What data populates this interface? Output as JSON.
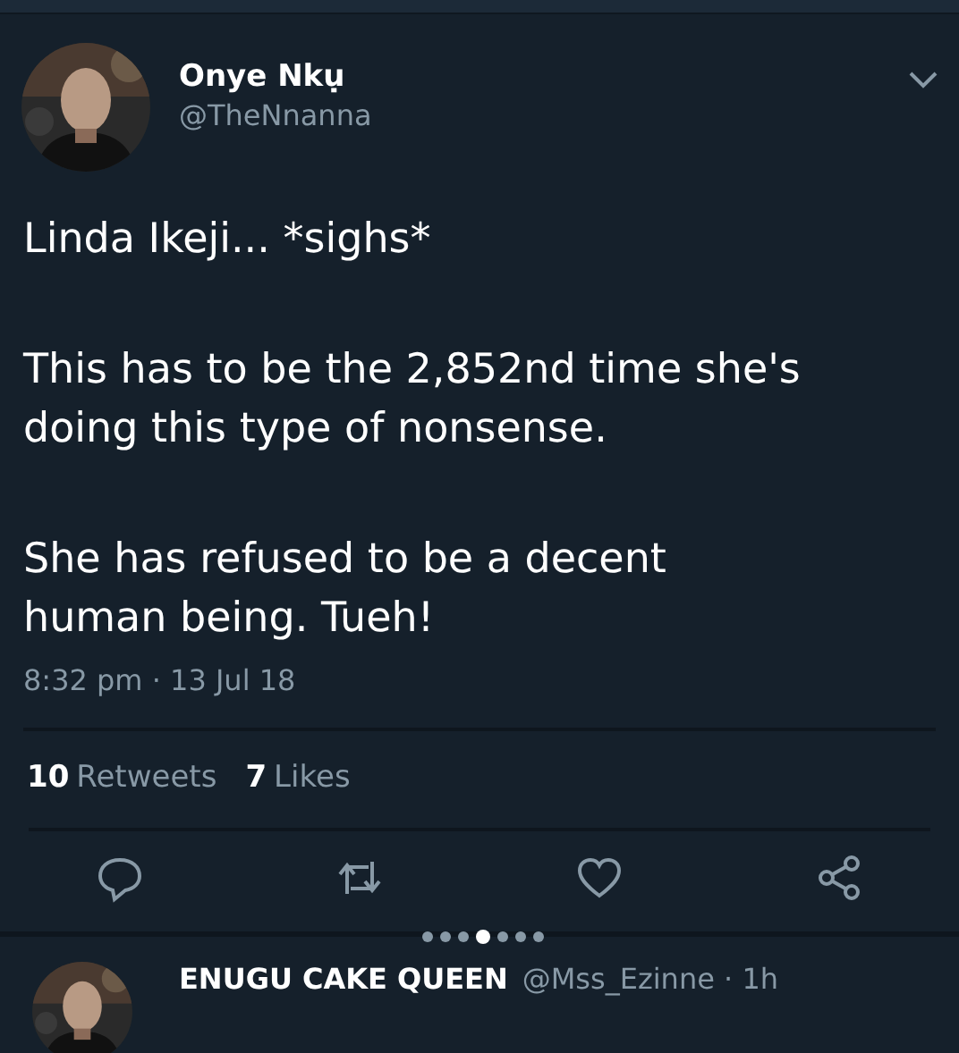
{
  "tweet": {
    "name": "Onye Nkụ",
    "handle": "@TheNnanna",
    "paragraphs": [
      [
        "Linda Ikeji... *sighs*"
      ],
      [
        "This has to be the 2,852nd time she's",
        "doing this type of nonsense."
      ],
      [
        "She has refused to be a decent",
        "human being. Tueh!"
      ]
    ],
    "timestamp": "8:32 pm · 13 Jul 18",
    "stats": [
      {
        "count": "10",
        "label": "Retweets"
      },
      {
        "count": "7",
        "label": "Likes"
      }
    ],
    "actions": [
      {
        "kind": "reply"
      },
      {
        "kind": "retweet"
      },
      {
        "kind": "like"
      },
      {
        "kind": "share"
      }
    ]
  },
  "carousel_dots": [
    {
      "selected": false
    },
    {
      "selected": false
    },
    {
      "selected": false
    },
    {
      "selected": true
    },
    {
      "selected": false
    },
    {
      "selected": false
    },
    {
      "selected": false
    }
  ],
  "next_tweet": {
    "name": "ENUGU CAKE QUEEN",
    "handle": "@Mss_Ezinne · 1h"
  }
}
